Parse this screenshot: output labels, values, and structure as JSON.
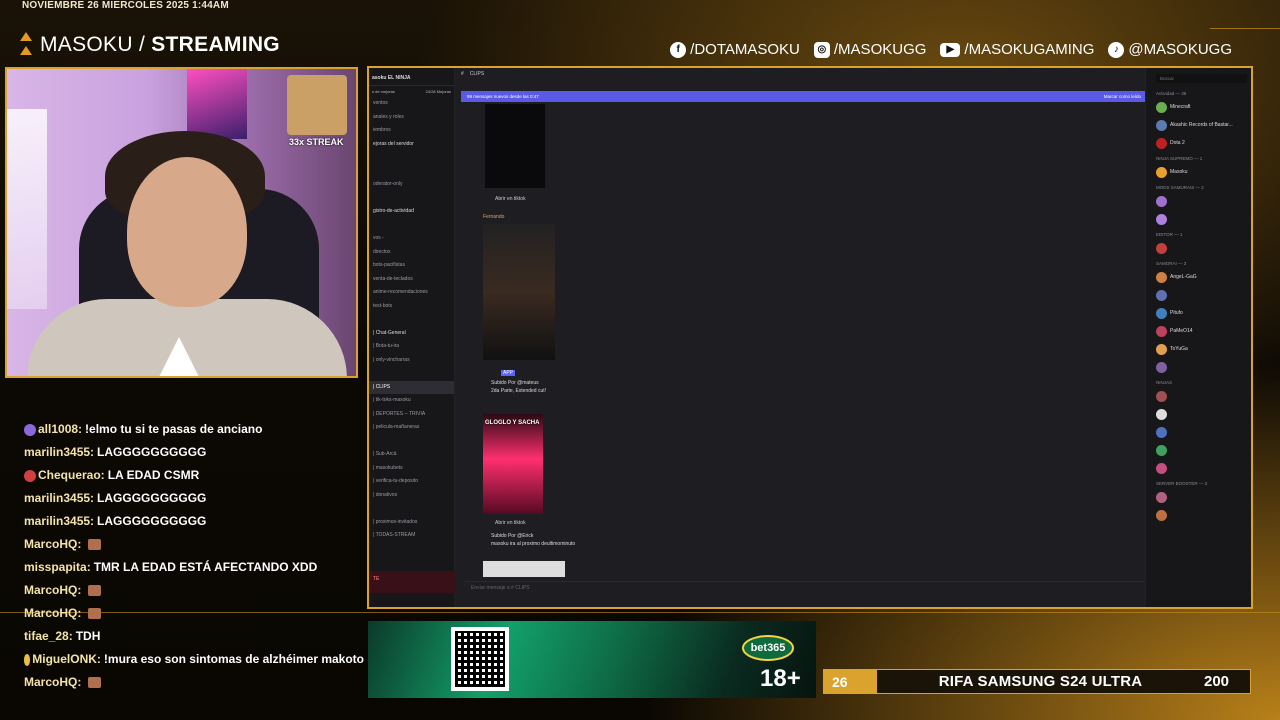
{
  "overlay": {
    "datetime": "NOVIEMBRE 26 MIERCOLES 2025 1:44AM",
    "brand_name": "MASOKU /",
    "brand_tag": "STREAMING",
    "socials": [
      {
        "icon": "facebook-icon",
        "glyph": "f",
        "label": "/DOTAMASOKU"
      },
      {
        "icon": "instagram-icon",
        "glyph": "◎",
        "label": "/MASOKUGG"
      },
      {
        "icon": "youtube-icon",
        "glyph": "▶",
        "label": "/MASOKUGAMING"
      },
      {
        "icon": "tiktok-icon",
        "glyph": "♪",
        "label": "@MASOKUGG"
      }
    ],
    "streak_label": "33x STREAK",
    "accent_color": "#d9a32e"
  },
  "chat": [
    {
      "user": "all1008:",
      "text": "!elmo tu si te pasas de anciano",
      "badge_color": "#8a6ad8"
    },
    {
      "user": "marilin3455:",
      "text": "LAGGGGGGGGGG",
      "badge_color": ""
    },
    {
      "user": "Chequerao:",
      "text": "LA EDAD CSMR",
      "badge_color": "#d04040"
    },
    {
      "user": "marilin3455:",
      "text": "LAGGGGGGGGGG",
      "badge_color": ""
    },
    {
      "user": "marilin3455:",
      "text": "LAGGGGGGGGGG",
      "badge_color": ""
    },
    {
      "user": "MarcoHQ:",
      "text": "",
      "emote": true,
      "badge_color": ""
    },
    {
      "user": "misspapita:",
      "text": "TMR LA EDAD ESTÁ AFECTANDO XDD",
      "badge_color": ""
    },
    {
      "user": "MarcoHQ:",
      "text": "",
      "emote": true,
      "badge_color": ""
    },
    {
      "user": "MarcoHQ:",
      "text": "",
      "emote": true,
      "badge_color": ""
    },
    {
      "user": "tifae_28:",
      "text": "TDH",
      "badge_color": ""
    },
    {
      "user": "MiguelONK:",
      "text": "!mura eso son sintomas de alzhéimer makoto",
      "badge_color": "#e8c040"
    },
    {
      "user": "MarcoHQ:",
      "text": "",
      "emote": true,
      "badge_color": ""
    }
  ],
  "discord": {
    "server_name": "asoku EL NINJA",
    "boost_text": "s de mejoras",
    "boost_count": "24/28 Mejoras",
    "channels": [
      {
        "label": "ventos",
        "state": ""
      },
      {
        "label": "anales y roles",
        "state": ""
      },
      {
        "label": "iembros",
        "state": ""
      },
      {
        "label": "ejoras del servidor",
        "state": "bright"
      },
      {
        "label": "",
        "state": ""
      },
      {
        "label": "",
        "state": ""
      },
      {
        "label": "oderator-only",
        "state": ""
      },
      {
        "label": "",
        "state": ""
      },
      {
        "label": "gistro-de-actividad",
        "state": "bright"
      },
      {
        "label": "",
        "state": ""
      },
      {
        "label": "vos -",
        "state": ""
      },
      {
        "label": "directos",
        "state": ""
      },
      {
        "label": "bots-pacifistas",
        "state": ""
      },
      {
        "label": "venta-de-teclados",
        "state": ""
      },
      {
        "label": "anime-recomendaciones",
        "state": ""
      },
      {
        "label": "test-bots",
        "state": ""
      },
      {
        "label": "",
        "state": ""
      },
      {
        "label": "| Chat-General",
        "state": "bright"
      },
      {
        "label": "| Bota-tu-ira",
        "state": ""
      },
      {
        "label": "| only-vincharras",
        "state": ""
      },
      {
        "label": "",
        "state": ""
      },
      {
        "label": "| CLIPS",
        "state": "active"
      },
      {
        "label": "| tik-toks-masoku",
        "state": ""
      },
      {
        "label": "| DEPORTES -- TRIVIA",
        "state": ""
      },
      {
        "label": "| pelicula-mañaneras",
        "state": ""
      },
      {
        "label": "",
        "state": ""
      },
      {
        "label": "| Sub-Arcā",
        "state": ""
      },
      {
        "label": "| masokubets",
        "state": ""
      },
      {
        "label": "| verifica-tu-deposito",
        "state": ""
      },
      {
        "label": "| donativos",
        "state": ""
      },
      {
        "label": "",
        "state": ""
      },
      {
        "label": "| proximos-invitados",
        "state": ""
      },
      {
        "label": "| TODAS-STREAM",
        "state": ""
      }
    ],
    "user_bar": "TE",
    "channel_title": "CLIPS",
    "banner_left": "99 mensajes nuevos desde las 0:47",
    "banner_right": "Marcar como leído",
    "open_tiktok": "Abrir en tiktok",
    "author_1": "Fernando",
    "app_badge": "APP",
    "uploaded_by_1": "Subido Por @mateus",
    "caption_1": "2da Parte, Extended cut!",
    "video_caption_pink": "GLOGLO Y SACHA",
    "uploaded_by_2": "Subido Por @Erick",
    "caption_2": "masoku ira al proximo deultimominuto",
    "input_placeholder": "Enviar mensaje a # CLIPS",
    "search_placeholder": "Buscar",
    "members": [
      {
        "type": "head",
        "label": "Actividad — 36"
      },
      {
        "type": "member",
        "name": "Minecraft",
        "color": "#6ab04c"
      },
      {
        "type": "member",
        "name": "Akashic Records of Bastar...",
        "color": "#5a7ab0"
      },
      {
        "type": "member",
        "name": "Dota 2",
        "color": "#c02020"
      },
      {
        "type": "head",
        "label": "NINJA SUPREMO — 1"
      },
      {
        "type": "member",
        "name": "Masoku",
        "color": "#e8a030"
      },
      {
        "type": "head",
        "label": "MODS SAMURAIS — 2"
      },
      {
        "type": "member",
        "name": "",
        "color": "#a070d0"
      },
      {
        "type": "member",
        "name": "",
        "color": "#b080e0"
      },
      {
        "type": "head",
        "label": "EDITOR — 1"
      },
      {
        "type": "member",
        "name": "",
        "color": "#c04040"
      },
      {
        "type": "head",
        "label": "SAMORAI — 3"
      },
      {
        "type": "member",
        "name": "AngeL-GaG",
        "color": "#d08040"
      },
      {
        "type": "member",
        "name": "",
        "color": "#6070b0"
      },
      {
        "type": "member",
        "name": "Pitufo",
        "color": "#4080c0"
      },
      {
        "type": "member",
        "name": "PaMeO14",
        "color": "#c04060"
      },
      {
        "type": "member",
        "name": "ToYuGa",
        "color": "#e0a050"
      },
      {
        "type": "member",
        "name": "",
        "color": "#8060a0"
      },
      {
        "type": "head",
        "label": "NINJAS"
      },
      {
        "type": "member",
        "name": "",
        "color": "#a05050"
      },
      {
        "type": "member",
        "name": "",
        "color": "#ddd"
      },
      {
        "type": "member",
        "name": "",
        "color": "#5070c0"
      },
      {
        "type": "member",
        "name": "",
        "color": "#40a060"
      },
      {
        "type": "member",
        "name": "",
        "color": "#c05080"
      },
      {
        "type": "head",
        "label": "SERVER BOOSTER — 3"
      },
      {
        "type": "member",
        "name": "",
        "color": "#b06080"
      },
      {
        "type": "member",
        "name": "",
        "color": "#c07040"
      }
    ]
  },
  "ad": {
    "brand": "bet365",
    "age_label": "18+"
  },
  "raffle": {
    "count": "26",
    "title": "RIFA SAMSUNG S24 ULTRA",
    "total": "200"
  }
}
